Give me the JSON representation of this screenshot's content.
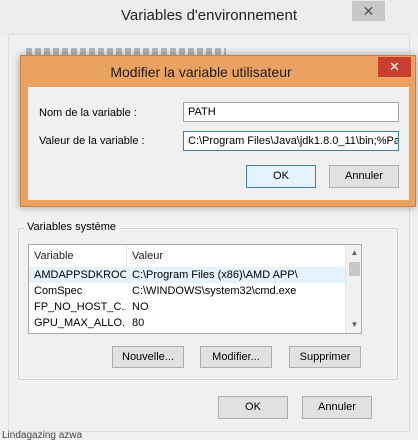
{
  "outer_window": {
    "title": "Variables d'environnement",
    "close_glyph": "✕",
    "system_vars": {
      "legend": "Variables système",
      "columns": [
        "Variable",
        "Valeur"
      ],
      "rows": [
        {
          "name": "AMDAPPSDKROOT",
          "value": "C:\\Program Files (x86)\\AMD APP\\"
        },
        {
          "name": "ComSpec",
          "value": "C:\\WINDOWS\\system32\\cmd.exe"
        },
        {
          "name": "FP_NO_HOST_C...",
          "value": "NO"
        },
        {
          "name": "GPU_MAX_ALLO...",
          "value": "80"
        }
      ],
      "buttons": {
        "new": "Nouvelle...",
        "modify": "Modifier...",
        "delete": "Supprimer"
      }
    },
    "ok_label": "OK",
    "cancel_label": "Annuler",
    "bottom_text": "Lindagazing azwa"
  },
  "modal": {
    "title": "Modifier la variable utilisateur",
    "close_glyph": "✕",
    "name_label": "Nom de la variable :",
    "value_label": "Valeur de la variable :",
    "name_value": "PATH",
    "value_value": "C:\\Program Files\\Java\\jdk1.8.0_11\\bin;%Pa",
    "ok_label": "OK",
    "cancel_label": "Annuler"
  },
  "colors": {
    "modal_frame": "#eaa262",
    "close_red": "#c8402d",
    "accent_blue": "#3c7fb1"
  },
  "icons": {
    "close": "close-icon",
    "scroll_up": "scroll-up-icon",
    "scroll_down": "scroll-down-icon"
  }
}
